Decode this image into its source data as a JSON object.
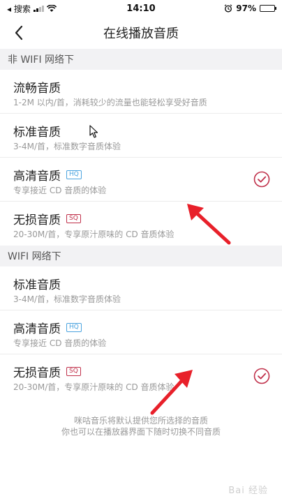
{
  "status_bar": {
    "carrier": "◂ 搜索",
    "time": "14:10",
    "battery": "97%",
    "battery_level": 0.97
  },
  "nav": {
    "title": "在线播放音质",
    "back_icon": "chevron-left-icon"
  },
  "sections": [
    {
      "title": "非 WIFI 网络下",
      "options": [
        {
          "title": "流畅音质",
          "desc": "1-2M 以内/首，消耗较少的流量也能轻松享受好音质",
          "badge": "",
          "selected": false
        },
        {
          "title": "标准音质",
          "desc": "3-4M/首，标准数字音质体验",
          "badge": "",
          "selected": false
        },
        {
          "title": "高清音质",
          "desc": "专享接近 CD 音质的体验",
          "badge": "HQ",
          "selected": true
        },
        {
          "title": "无损音质",
          "desc": "20-30M/首，专享原汁原味的 CD 音质体验",
          "badge": "SQ",
          "selected": false
        }
      ]
    },
    {
      "title": "WIFI 网络下",
      "options": [
        {
          "title": "标准音质",
          "desc": "3-4M/首，标准数字音质体验",
          "badge": "",
          "selected": false
        },
        {
          "title": "高清音质",
          "desc": "专享接近 CD 音质的体验",
          "badge": "HQ",
          "selected": false
        },
        {
          "title": "无损音质",
          "desc": "20-30M/首，专享原汁原味的 CD 音质体验",
          "badge": "SQ",
          "selected": true
        }
      ]
    }
  ],
  "footer": {
    "line1": "咪咕音乐将默认提供您所选择的音质",
    "line2": "你也可以在播放器界面下随时切换不同音质"
  },
  "watermark": "Bai 经验",
  "colors": {
    "accent": "#c0304a",
    "hq": "#4aa3df",
    "annotation": "#e8202a"
  }
}
